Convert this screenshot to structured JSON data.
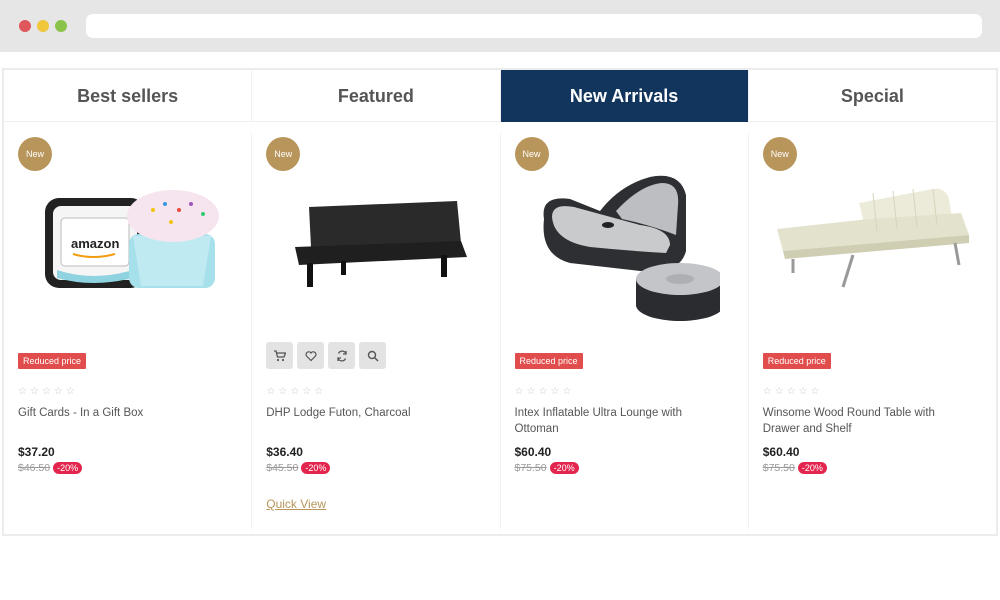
{
  "tabs": [
    {
      "label": "Best sellers",
      "active": false
    },
    {
      "label": "Featured",
      "active": false
    },
    {
      "label": "New Arrivals",
      "active": true
    },
    {
      "label": "Special",
      "active": false
    }
  ],
  "products": [
    {
      "badge": "New",
      "reduced_label": "Reduced price",
      "name": "Gift Cards - In a Gift Box",
      "price": "$37.20",
      "old_price": "$46.50",
      "discount": "-20%"
    },
    {
      "badge": "New",
      "name": "DHP Lodge Futon, Charcoal",
      "price": "$36.40",
      "old_price": "$45.50",
      "discount": "-20%",
      "quick_view": "Quick View"
    },
    {
      "badge": "New",
      "reduced_label": "Reduced price",
      "name": "Intex Inflatable Ultra Lounge with Ottoman",
      "price": "$60.40",
      "old_price": "$75.50",
      "discount": "-20%"
    },
    {
      "badge": "New",
      "reduced_label": "Reduced price",
      "name": "Winsome Wood Round Table with Drawer and Shelf",
      "price": "$60.40",
      "old_price": "$75.50",
      "discount": "-20%"
    }
  ],
  "icons": {
    "cart": "cart-icon",
    "wishlist": "heart-icon",
    "compare": "refresh-icon",
    "quickview": "search-icon"
  },
  "colors": {
    "active_tab": "#11355c",
    "badge": "#b8955a",
    "reduced": "#e14c4c",
    "discount": "#e2264d"
  }
}
